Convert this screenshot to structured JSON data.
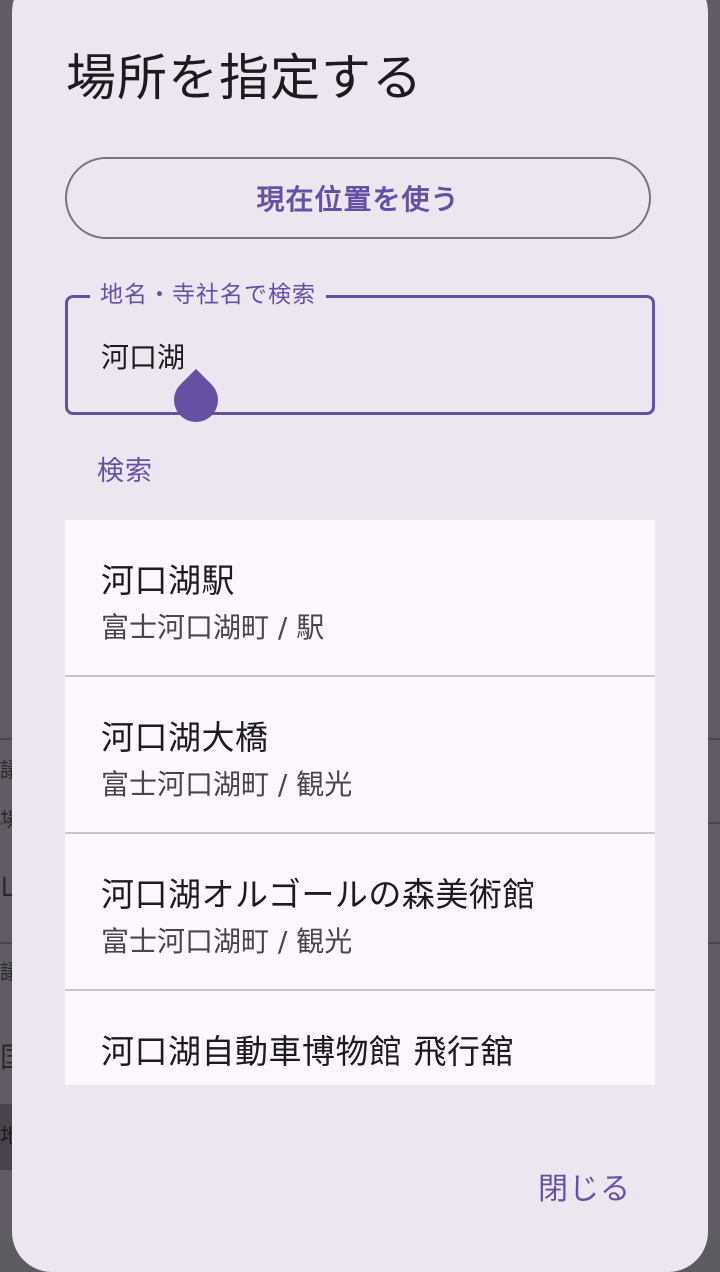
{
  "background": {
    "glyphs": [
      "議",
      "場",
      "山",
      "議",
      "国",
      "地"
    ]
  },
  "dialog": {
    "title": "場所を指定する",
    "use_location_label": "現在位置を使う",
    "search_field": {
      "label": "地名・寺社名で検索",
      "value": "河口湖"
    },
    "search_label": "検索",
    "results": [
      {
        "name": "河口湖駅",
        "subtitle": "富士河口湖町 / 駅"
      },
      {
        "name": "河口湖大橋",
        "subtitle": "富士河口湖町 / 観光"
      },
      {
        "name": "河口湖オルゴールの森美術館",
        "subtitle": "富士河口湖町 / 観光"
      },
      {
        "name": "河口湖自動車博物館 飛行舘",
        "subtitle": ""
      }
    ],
    "close_label": "閉じる"
  },
  "colors": {
    "accent": "#6750a4",
    "dialog_bg": "#ece6f0",
    "list_bg": "#fcf7fc",
    "scrim": "#5d5b61"
  }
}
